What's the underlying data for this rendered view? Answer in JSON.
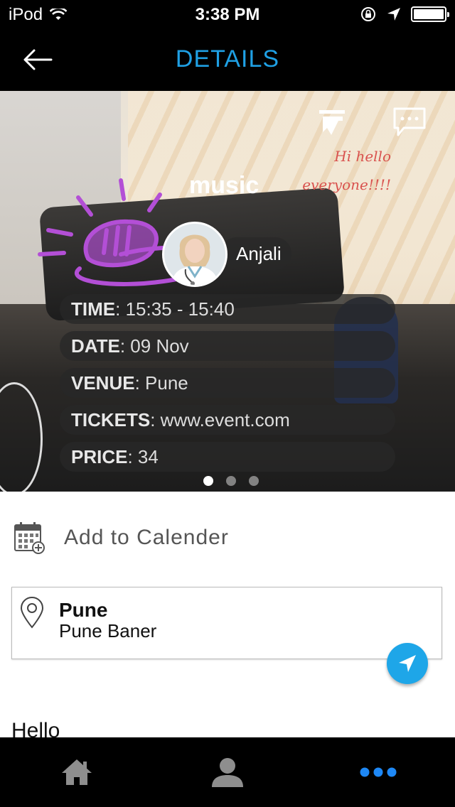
{
  "status_bar": {
    "carrier": "iPod",
    "time": "3:38 PM"
  },
  "nav": {
    "title": "DETAILS"
  },
  "hero": {
    "overlay_word": "music",
    "handwritten_line1": "Hi hello",
    "handwritten_line2": "everyone!!!!",
    "user_name": "Anjali",
    "details": [
      {
        "key": "TIME",
        "value": ": 15:35 - 15:40"
      },
      {
        "key": "DATE",
        "value": ": 09 Nov"
      },
      {
        "key": "VENUE",
        "value": ": Pune"
      },
      {
        "key": "TICKETS",
        "value": ": www.event.com"
      },
      {
        "key": "PRICE",
        "value": ": 34"
      }
    ],
    "page_count": 3,
    "active_page": 1
  },
  "calendar": {
    "label": "Add to Calender"
  },
  "location": {
    "title": "Pune",
    "subtitle": "Pune Baner"
  },
  "description": {
    "text": "Hello"
  },
  "colors": {
    "accent": "#1fa0e4",
    "fab": "#1ea6e8",
    "doodle": "#b34fd6",
    "tab_active": "#1e88f5",
    "tab_inactive": "#8e8e8e"
  },
  "icons": [
    "back-arrow-icon",
    "share-icon",
    "chat-icon",
    "calendar-add-icon",
    "map-pin-icon",
    "navigation-arrow-icon",
    "home-icon",
    "profile-icon",
    "more-dots-icon"
  ]
}
